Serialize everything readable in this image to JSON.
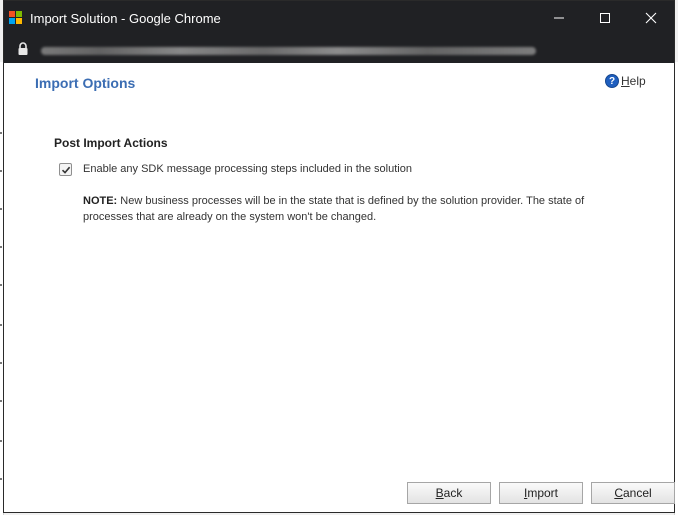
{
  "window": {
    "title": "Import Solution - Google Chrome",
    "controls": [
      "minimize",
      "maximize",
      "close"
    ]
  },
  "address_bar": {
    "icon": "lock-icon"
  },
  "page": {
    "title": "Import Options",
    "help_label": "Help",
    "help_icon_glyph": "?"
  },
  "post_import": {
    "heading": "Post Import Actions",
    "checkbox_label": "Enable any SDK message processing steps included in the solution",
    "checkbox_checked": true,
    "note_label": "NOTE:",
    "note_text": "New business processes will be in the state that is defined by the solution provider. The state of processes that are already on the system won't be changed."
  },
  "buttons": {
    "back": "Back",
    "import": "Import",
    "cancel": "Cancel"
  },
  "colors": {
    "titlebar": "#202124",
    "accent": "#3b6db3",
    "help_icon": "#1f5fbf"
  }
}
